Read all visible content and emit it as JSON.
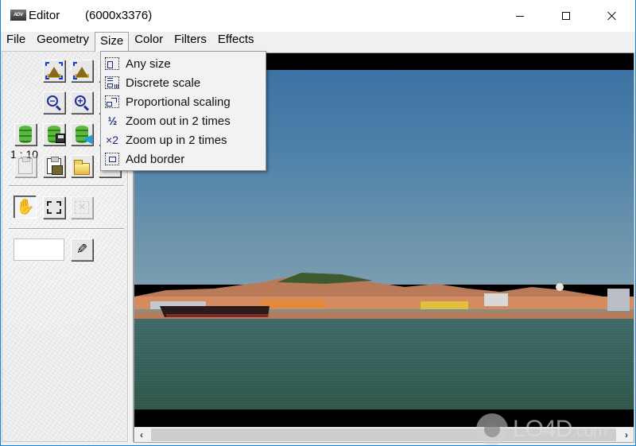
{
  "window": {
    "app_title": "Editor",
    "image_dimensions": "(6000x3376)",
    "app_icon_label": "ADV",
    "controls": {
      "minimize": "minimize",
      "maximize": "maximize",
      "close": "close"
    }
  },
  "menubar": {
    "items": [
      {
        "label": "File"
      },
      {
        "label": "Geometry"
      },
      {
        "label": "Size",
        "active": true
      },
      {
        "label": "Color"
      },
      {
        "label": "Filters"
      },
      {
        "label": "Effects"
      }
    ]
  },
  "size_menu": {
    "items": [
      {
        "label": "Any size",
        "icon": "any-size-icon"
      },
      {
        "label": "Discrete scale",
        "icon": "discrete-scale-icon"
      },
      {
        "label": "Proportional scaling",
        "icon": "proportional-scaling-icon"
      },
      {
        "label": "Zoom out in 2 times",
        "icon": "half-icon",
        "glyph": "½"
      },
      {
        "label": "Zoom up in 2 times",
        "icon": "times-two-icon",
        "glyph": "×2"
      },
      {
        "label": "Add border",
        "icon": "add-border-icon"
      }
    ]
  },
  "toolpanel": {
    "zoom_ratio": "1 : 10",
    "zoom_out_glyph": "−",
    "zoom_in_glyph": "+",
    "hand_glyph": "✋",
    "pencil_glyph": "✎",
    "color_value": ""
  },
  "scrollbar": {
    "left_arrow": "‹",
    "right_arrow": "›"
  },
  "watermark": {
    "text": "LO4D",
    "suffix": ".com"
  }
}
